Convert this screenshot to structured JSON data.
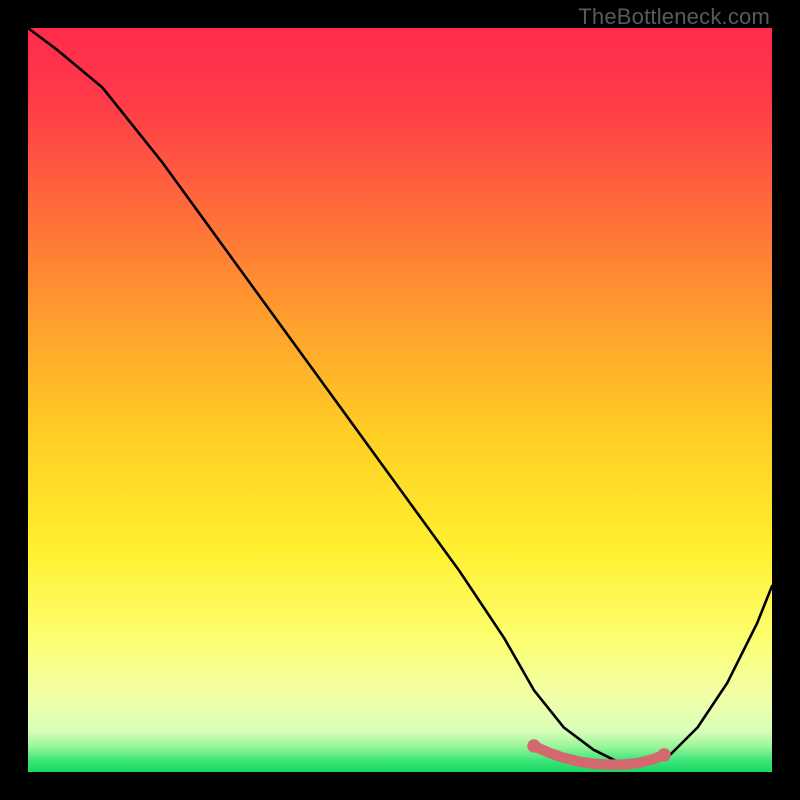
{
  "watermark": "TheBottleneck.com",
  "colors": {
    "top": "#ff2b4c",
    "mid_upper": "#ff8f2e",
    "mid": "#ffd223",
    "mid_lower": "#fff95a",
    "lower": "#f6ffb0",
    "bottom": "#25e06a",
    "curve": "#000000",
    "highlight": "#d4686f",
    "frame": "#000000"
  },
  "chart_data": {
    "type": "line",
    "title": "",
    "xlabel": "",
    "ylabel": "",
    "xlim": [
      0,
      100
    ],
    "ylim": [
      0,
      100
    ],
    "series": [
      {
        "name": "bottleneck-curve",
        "x": [
          0,
          4,
          10,
          18,
          26,
          34,
          42,
          50,
          58,
          64,
          68,
          72,
          76,
          80,
          83,
          86,
          90,
          94,
          98,
          100
        ],
        "y": [
          100,
          97,
          92,
          82,
          71,
          60,
          49,
          38,
          27,
          18,
          11,
          6,
          3,
          1,
          1,
          2,
          6,
          12,
          20,
          25
        ]
      },
      {
        "name": "optimal-range-highlight",
        "x": [
          68,
          70,
          72,
          74,
          76,
          78,
          80,
          82,
          84,
          85.5
        ],
        "y": [
          3.5,
          2.6,
          1.9,
          1.4,
          1.1,
          1.0,
          1.0,
          1.2,
          1.7,
          2.3
        ]
      }
    ],
    "annotations": []
  }
}
